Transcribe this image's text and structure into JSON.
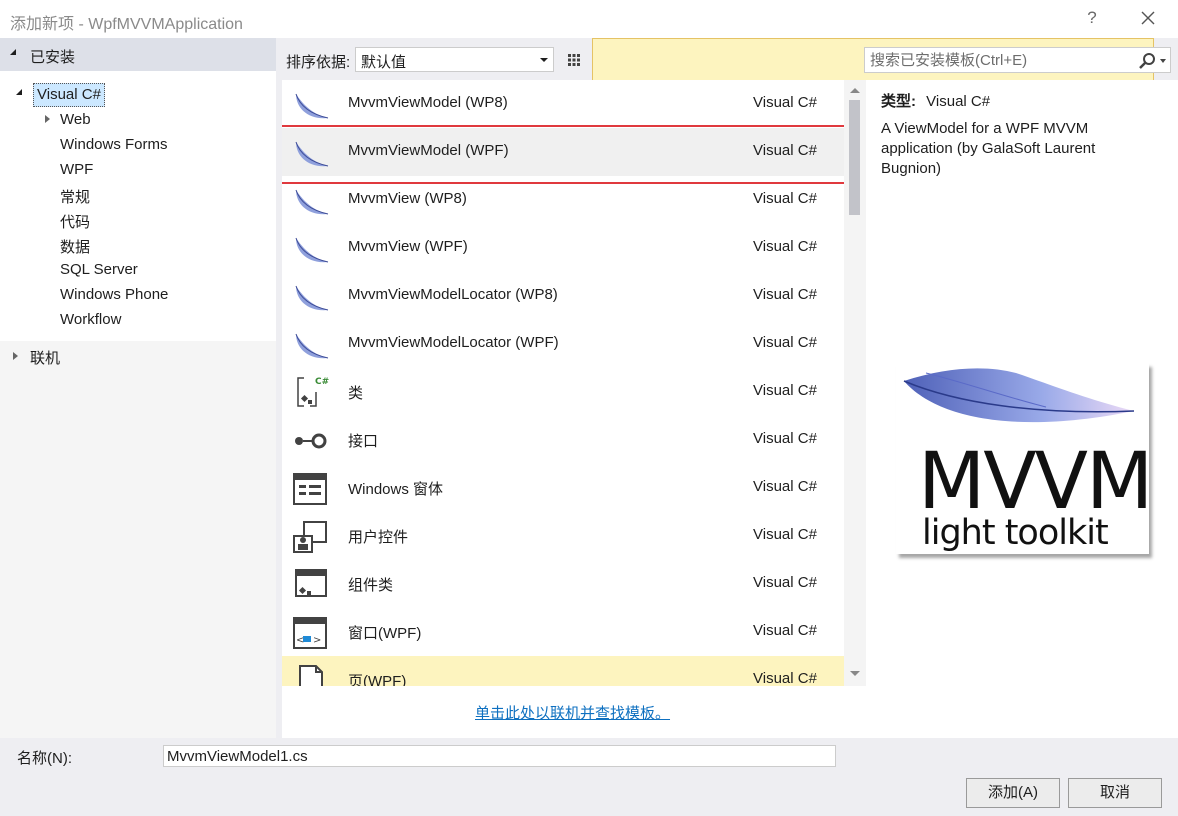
{
  "window": {
    "title": "添加新项 - WpfMVVMApplication",
    "help_label": "?"
  },
  "sidebar": {
    "installed_label": "已安装",
    "root_label": "Visual C#",
    "items": [
      {
        "label": "Web"
      },
      {
        "label": "Windows Forms"
      },
      {
        "label": "WPF"
      },
      {
        "label": "常规"
      },
      {
        "label": "代码"
      },
      {
        "label": "数据"
      },
      {
        "label": "SQL Server"
      },
      {
        "label": "Windows Phone"
      },
      {
        "label": "Workflow"
      }
    ],
    "online_label": "联机"
  },
  "toolbar": {
    "sort_label": "排序依据:",
    "sort_value": "默认值"
  },
  "search": {
    "placeholder": "搜索已安装模板(Ctrl+E)"
  },
  "templates": [
    {
      "name": "MvvmViewModel (WP8)",
      "lang": "Visual C#",
      "icon": "feather-icon"
    },
    {
      "name": "MvvmViewModel (WPF)",
      "lang": "Visual C#",
      "icon": "feather-icon"
    },
    {
      "name": "MvvmView (WP8)",
      "lang": "Visual C#",
      "icon": "feather-icon"
    },
    {
      "name": "MvvmView (WPF)",
      "lang": "Visual C#",
      "icon": "feather-icon"
    },
    {
      "name": "MvvmViewModelLocator (WP8)",
      "lang": "Visual C#",
      "icon": "feather-icon"
    },
    {
      "name": "MvvmViewModelLocator (WPF)",
      "lang": "Visual C#",
      "icon": "feather-icon"
    },
    {
      "name": "类",
      "lang": "Visual C#",
      "icon": "class-icon"
    },
    {
      "name": "接口",
      "lang": "Visual C#",
      "icon": "interface-icon"
    },
    {
      "name": "Windows 窗体",
      "lang": "Visual C#",
      "icon": "windows-form-icon"
    },
    {
      "name": "用户控件",
      "lang": "Visual C#",
      "icon": "user-control-icon"
    },
    {
      "name": "组件类",
      "lang": "Visual C#",
      "icon": "component-class-icon"
    },
    {
      "name": "窗口(WPF)",
      "lang": "Visual C#",
      "icon": "wpf-window-icon"
    },
    {
      "name": "页(WPF)",
      "lang": "Visual C#",
      "icon": "wpf-page-icon"
    }
  ],
  "online_link": "单击此处以联机并查找模板。",
  "details": {
    "type_key": "类型:",
    "type_value": "Visual C#",
    "description": "A ViewModel for a WPF MVVM application (by GalaSoft Laurent Bugnion)",
    "logo_title": "MVVM",
    "logo_subtitle": "light toolkit"
  },
  "footer": {
    "name_label": "名称(N):",
    "name_value": "MvvmViewModel1.cs",
    "add_label": "添加(A)",
    "cancel_label": "取消"
  },
  "colors": {
    "selection_outline": "#e0393e",
    "link": "#0e70c0",
    "hover_row": "#fdf4bf"
  }
}
